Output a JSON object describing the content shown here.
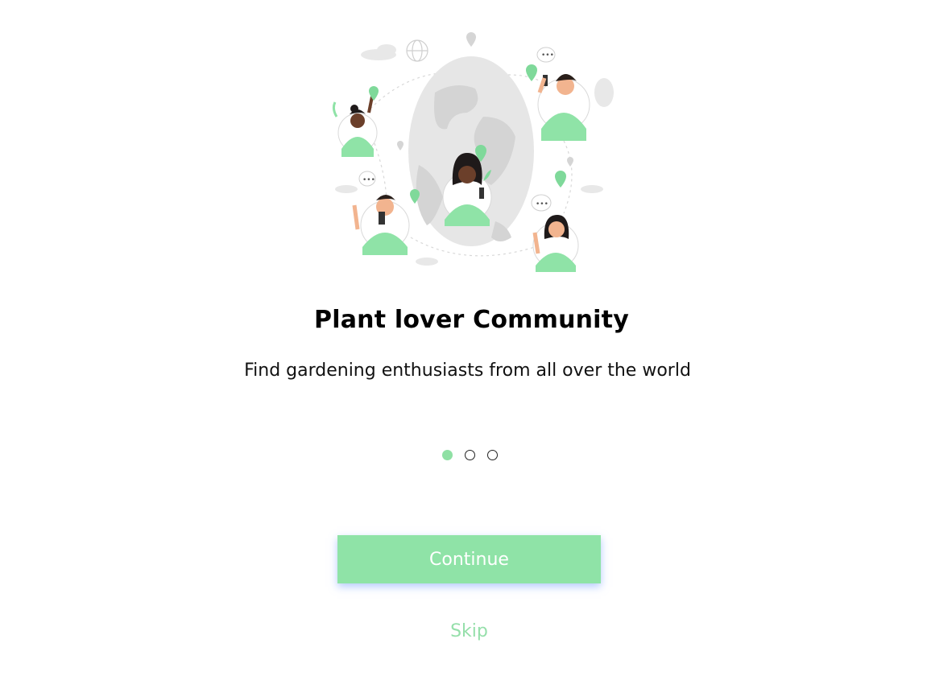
{
  "onboarding": {
    "title": "Plant lover Community",
    "subtitle": "Find gardening enthusiasts from all over the world",
    "pagination": {
      "total": 3,
      "active_index": 0
    },
    "continue_label": "Continue",
    "skip_label": "Skip"
  },
  "illustration": {
    "icon": "community-globe-illustration"
  },
  "colors": {
    "accent_green": "#8fe3a7",
    "skip_green": "#95dfaa",
    "button_shadow": "#78a0ff",
    "globe_gray": "#e6e6e6",
    "skin_dark": "#6b3f2a",
    "skin_light": "#f2b48f"
  }
}
